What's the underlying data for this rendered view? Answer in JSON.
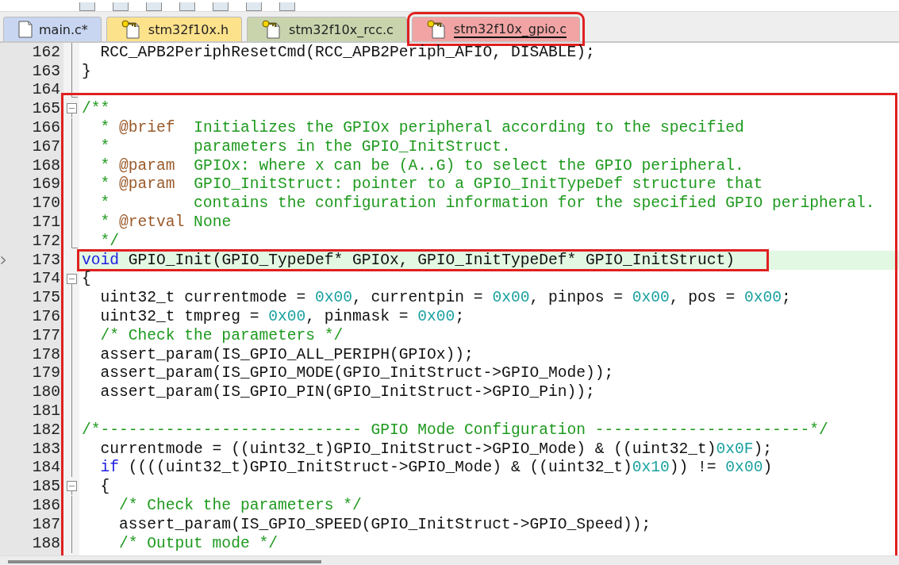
{
  "tabs": [
    {
      "label": "main.c*",
      "selected": false,
      "locked": false,
      "color": "#c8d6f2"
    },
    {
      "label": "stm32f10x.h",
      "selected": false,
      "locked": true,
      "color": "#fde28c"
    },
    {
      "label": "stm32f10x_rcc.c",
      "selected": false,
      "locked": true,
      "color": "#c9d4ad"
    },
    {
      "label": "stm32f10x_gpio.c",
      "selected": true,
      "locked": true,
      "color": "#f2a4a4",
      "annotated": true
    }
  ],
  "editor": {
    "lines": [
      {
        "number": "162",
        "kind": "line",
        "tokens": [
          {
            "kind": "plain",
            "text": "  RCC_APB2PeriphResetCmd(RCC_APB2Periph_AFIO, DISABLE);"
          }
        ]
      },
      {
        "number": "163",
        "kind": "line",
        "tokens": [
          {
            "kind": "plain",
            "text": "}"
          }
        ]
      },
      {
        "number": "164",
        "kind": "end"
      },
      {
        "number": "165",
        "kind": "start",
        "outline_start": true,
        "tokens": [
          {
            "kind": "comment",
            "text": "/**"
          }
        ]
      },
      {
        "number": "166",
        "kind": "line",
        "tokens": [
          {
            "kind": "comment",
            "text": "  * "
          },
          {
            "kind": "doctag",
            "text": "@brief"
          },
          {
            "kind": "comment",
            "text": "  Initializes the GPIOx peripheral according to the specified"
          }
        ]
      },
      {
        "number": "167",
        "kind": "line",
        "tokens": [
          {
            "kind": "comment",
            "text": "  *         parameters in the GPIO_InitStruct."
          }
        ]
      },
      {
        "number": "168",
        "kind": "line",
        "tokens": [
          {
            "kind": "comment",
            "text": "  * "
          },
          {
            "kind": "doctag",
            "text": "@param"
          },
          {
            "kind": "comment",
            "text": "  GPIOx: where x can be (A..G) to select the GPIO peripheral."
          }
        ]
      },
      {
        "number": "169",
        "kind": "line",
        "tokens": [
          {
            "kind": "comment",
            "text": "  * "
          },
          {
            "kind": "doctag",
            "text": "@param"
          },
          {
            "kind": "comment",
            "text": "  GPIO_InitStruct: pointer to a GPIO_InitTypeDef structure that"
          }
        ]
      },
      {
        "number": "170",
        "kind": "line",
        "tokens": [
          {
            "kind": "comment",
            "text": "  *         contains the configuration information for the specified GPIO peripheral."
          }
        ]
      },
      {
        "number": "171",
        "kind": "line",
        "tokens": [
          {
            "kind": "comment",
            "text": "  * "
          },
          {
            "kind": "doctag",
            "text": "@retval"
          },
          {
            "kind": "comment",
            "text": " None"
          }
        ]
      },
      {
        "number": "172",
        "kind": "end",
        "tokens": [
          {
            "kind": "comment",
            "text": "  */"
          }
        ]
      },
      {
        "number": "173",
        "kind": "none",
        "current": true,
        "boxed": true,
        "tokens": [
          {
            "kind": "keyword",
            "text": "void"
          },
          {
            "kind": "plain",
            "text": " GPIO_Init(GPIO_TypeDef* GPIOx, GPIO_InitTypeDef* GPIO_InitStruct)"
          }
        ]
      },
      {
        "number": "174",
        "kind": "start",
        "tokens": [
          {
            "kind": "plain",
            "text": "{"
          }
        ]
      },
      {
        "number": "175",
        "kind": "line",
        "tokens": [
          {
            "kind": "plain",
            "text": "  uint32_t currentmode = "
          },
          {
            "kind": "number",
            "text": "0x00"
          },
          {
            "kind": "plain",
            "text": ", currentpin = "
          },
          {
            "kind": "number",
            "text": "0x00"
          },
          {
            "kind": "plain",
            "text": ", pinpos = "
          },
          {
            "kind": "number",
            "text": "0x00"
          },
          {
            "kind": "plain",
            "text": ", pos = "
          },
          {
            "kind": "number",
            "text": "0x00"
          },
          {
            "kind": "plain",
            "text": ";"
          }
        ]
      },
      {
        "number": "176",
        "kind": "line",
        "tokens": [
          {
            "kind": "plain",
            "text": "  uint32_t tmpreg = "
          },
          {
            "kind": "number",
            "text": "0x00"
          },
          {
            "kind": "plain",
            "text": ", pinmask = "
          },
          {
            "kind": "number",
            "text": "0x00"
          },
          {
            "kind": "plain",
            "text": ";"
          }
        ]
      },
      {
        "number": "177",
        "kind": "line",
        "tokens": [
          {
            "kind": "comment",
            "text": "  /* Check the parameters */"
          }
        ]
      },
      {
        "number": "178",
        "kind": "line",
        "tokens": [
          {
            "kind": "plain",
            "text": "  assert_param(IS_GPIO_ALL_PERIPH(GPIOx));"
          }
        ]
      },
      {
        "number": "179",
        "kind": "line",
        "tokens": [
          {
            "kind": "plain",
            "text": "  assert_param(IS_GPIO_MODE(GPIO_InitStruct->GPIO_Mode));"
          }
        ]
      },
      {
        "number": "180",
        "kind": "line",
        "tokens": [
          {
            "kind": "plain",
            "text": "  assert_param(IS_GPIO_PIN(GPIO_InitStruct->GPIO_Pin));"
          }
        ]
      },
      {
        "number": "181",
        "kind": "line"
      },
      {
        "number": "182",
        "kind": "line",
        "tokens": [
          {
            "kind": "comment",
            "text": "/*---------------------------- GPIO Mode Configuration -----------------------*/"
          }
        ]
      },
      {
        "number": "183",
        "kind": "line",
        "tokens": [
          {
            "kind": "plain",
            "text": "  currentmode = ((uint32_t)GPIO_InitStruct->GPIO_Mode) & ((uint32_t)"
          },
          {
            "kind": "number",
            "text": "0x0F"
          },
          {
            "kind": "plain",
            "text": ");"
          }
        ]
      },
      {
        "number": "184",
        "kind": "line",
        "tokens": [
          {
            "kind": "keyword",
            "text": "  if"
          },
          {
            "kind": "plain",
            "text": " ((((uint32_t)GPIO_InitStruct->GPIO_Mode) & ((uint32_t)"
          },
          {
            "kind": "number",
            "text": "0x10"
          },
          {
            "kind": "plain",
            "text": ")) != "
          },
          {
            "kind": "number",
            "text": "0x00"
          },
          {
            "kind": "plain",
            "text": ")"
          }
        ]
      },
      {
        "number": "185",
        "kind": "start",
        "tokens": [
          {
            "kind": "plain",
            "text": "  {"
          }
        ]
      },
      {
        "number": "186",
        "kind": "line",
        "tokens": [
          {
            "kind": "comment",
            "text": "    /* Check the parameters */"
          }
        ]
      },
      {
        "number": "187",
        "kind": "line",
        "tokens": [
          {
            "kind": "plain",
            "text": "    assert_param(IS_GPIO_SPEED(GPIO_InitStruct->GPIO_Speed));"
          }
        ]
      },
      {
        "number": "188",
        "kind": "line",
        "tokens": [
          {
            "kind": "comment",
            "text": "    /* Output mode */"
          }
        ]
      }
    ]
  }
}
